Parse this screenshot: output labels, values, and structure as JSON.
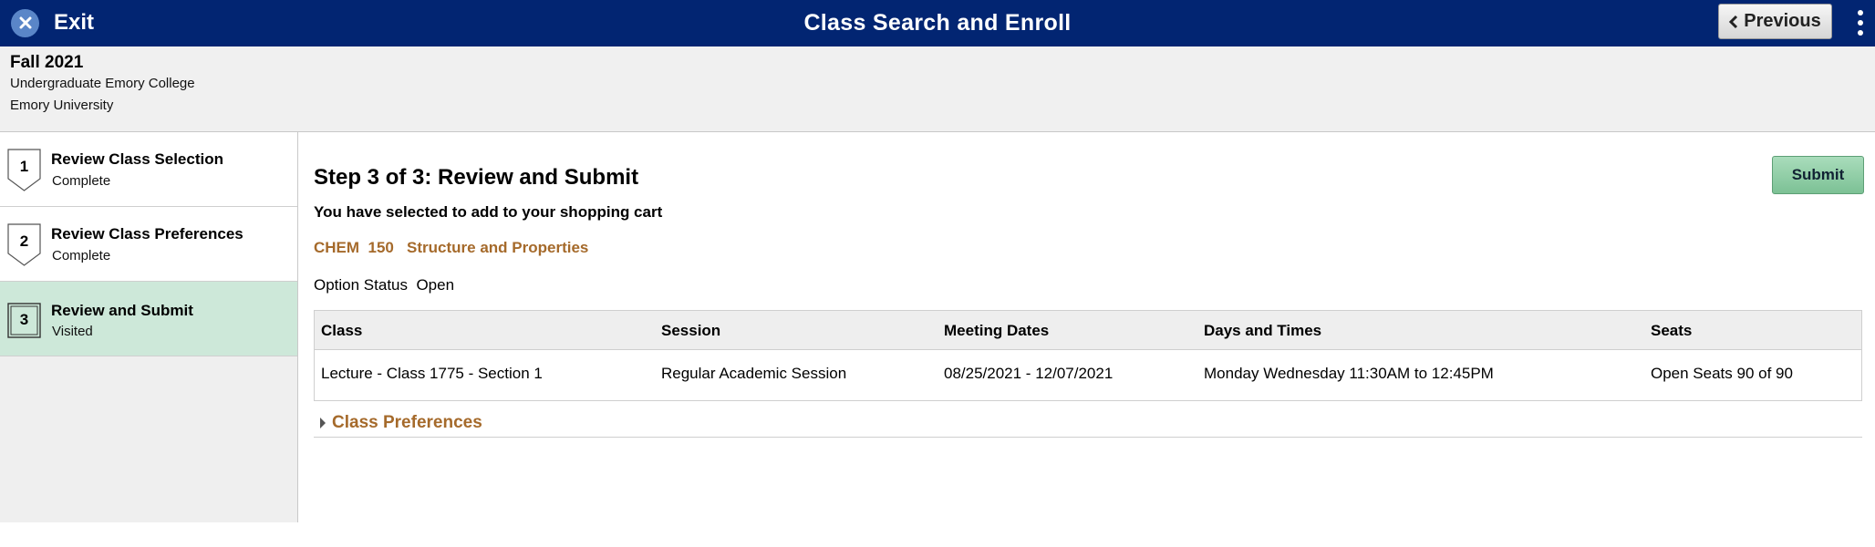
{
  "header": {
    "exit_label": "Exit",
    "title": "Class Search and Enroll",
    "previous_label": "Previous"
  },
  "term": {
    "name": "Fall 2021",
    "career": "Undergraduate Emory College",
    "institution": "Emory University"
  },
  "steps": [
    {
      "number": "1",
      "title": "Review Class Selection",
      "status": "Complete"
    },
    {
      "number": "2",
      "title": "Review Class Preferences",
      "status": "Complete"
    },
    {
      "number": "3",
      "title": "Review and Submit",
      "status": "Visited"
    }
  ],
  "main": {
    "heading": "Step 3 of 3: Review and Submit",
    "submit_label": "Submit",
    "cart_message": "You have selected to add to your shopping cart",
    "course_title": "CHEM  150   Structure and Properties",
    "option_status": "Option Status  Open"
  },
  "table": {
    "headers": [
      "Class",
      "Session",
      "Meeting Dates",
      "Days and Times",
      "Seats"
    ],
    "rows": [
      [
        "Lecture - Class 1775 - Section 1",
        "Regular Academic Session",
        "08/25/2021 - 12/07/2021",
        "Monday Wednesday   11:30AM to 12:45PM",
        "Open Seats 90 of 90"
      ]
    ]
  },
  "class_preferences_label": "Class Preferences",
  "colors": {
    "header_bg": "#022572",
    "accent_link": "#a56a2b",
    "active_step_bg": "#cde8d9",
    "submit_bg": "#8fcca5"
  },
  "icons": {
    "exit": "close-circle-icon",
    "previous": "chevron-left-icon",
    "menu": "kebab-menu-icon",
    "expand": "caret-right-icon"
  }
}
